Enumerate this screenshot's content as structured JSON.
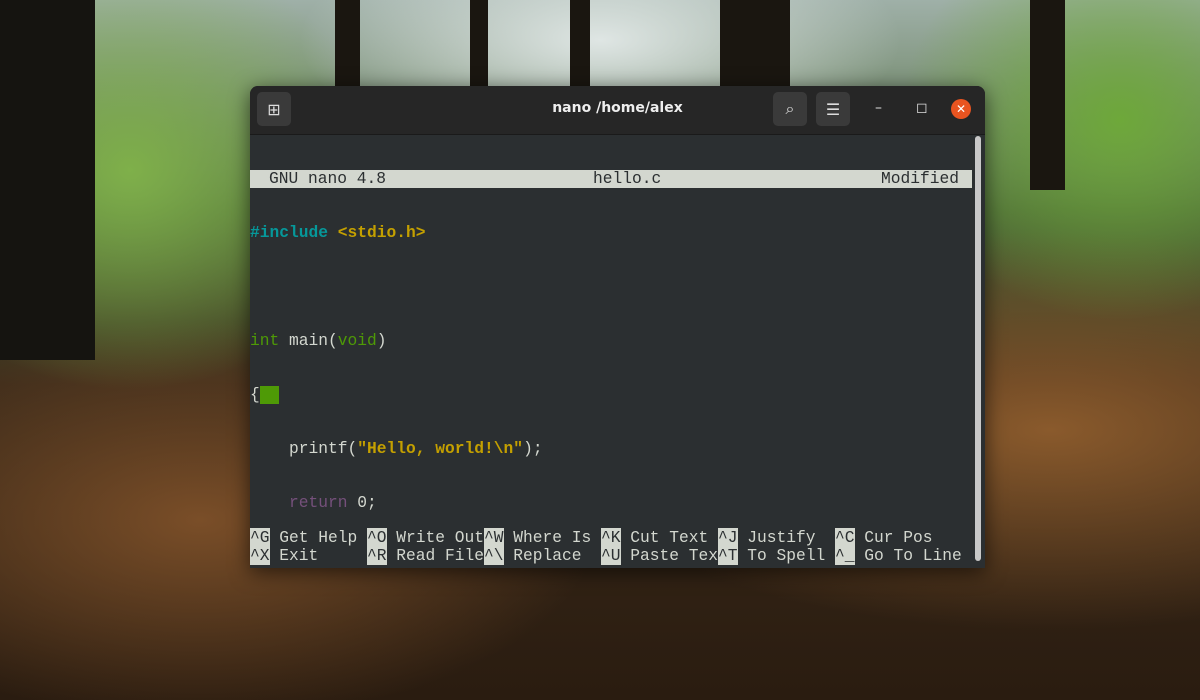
{
  "window": {
    "title": "nano /home/alex",
    "new_tab_icon": "new-tab-icon",
    "search_icon": "search-icon",
    "menu_icon": "hamburger-icon"
  },
  "nano": {
    "version": "GNU nano 4.8",
    "filename": "hello.c",
    "status": "Modified"
  },
  "code": {
    "l1a": "#include",
    "l1b": " <stdio.h>",
    "l3a": "int",
    "l3b": " main(",
    "l3c": "void",
    "l3d": ")",
    "l4": "{",
    "l5a": "    printf(",
    "l5b": "\"Hello, world!\\n\"",
    "l5c": ");",
    "l6a": "    ",
    "l6b": "return",
    "l6c": " 0;",
    "l7": "}"
  },
  "shortcuts": [
    [
      {
        "key": "^G",
        "label": "Get Help"
      },
      {
        "key": "^X",
        "label": "Exit"
      }
    ],
    [
      {
        "key": "^O",
        "label": "Write Out"
      },
      {
        "key": "^R",
        "label": "Read File"
      }
    ],
    [
      {
        "key": "^W",
        "label": "Where Is"
      },
      {
        "key": "^\\",
        "label": "Replace"
      }
    ],
    [
      {
        "key": "^K",
        "label": "Cut Text"
      },
      {
        "key": "^U",
        "label": "Paste Text"
      }
    ],
    [
      {
        "key": "^J",
        "label": "Justify"
      },
      {
        "key": "^T",
        "label": "To Spell"
      }
    ],
    [
      {
        "key": "^C",
        "label": "Cur Pos"
      },
      {
        "key": "^_",
        "label": "Go To Line"
      }
    ]
  ],
  "colors": {
    "accent": "#e95420",
    "cursor": "#4e9a06"
  }
}
